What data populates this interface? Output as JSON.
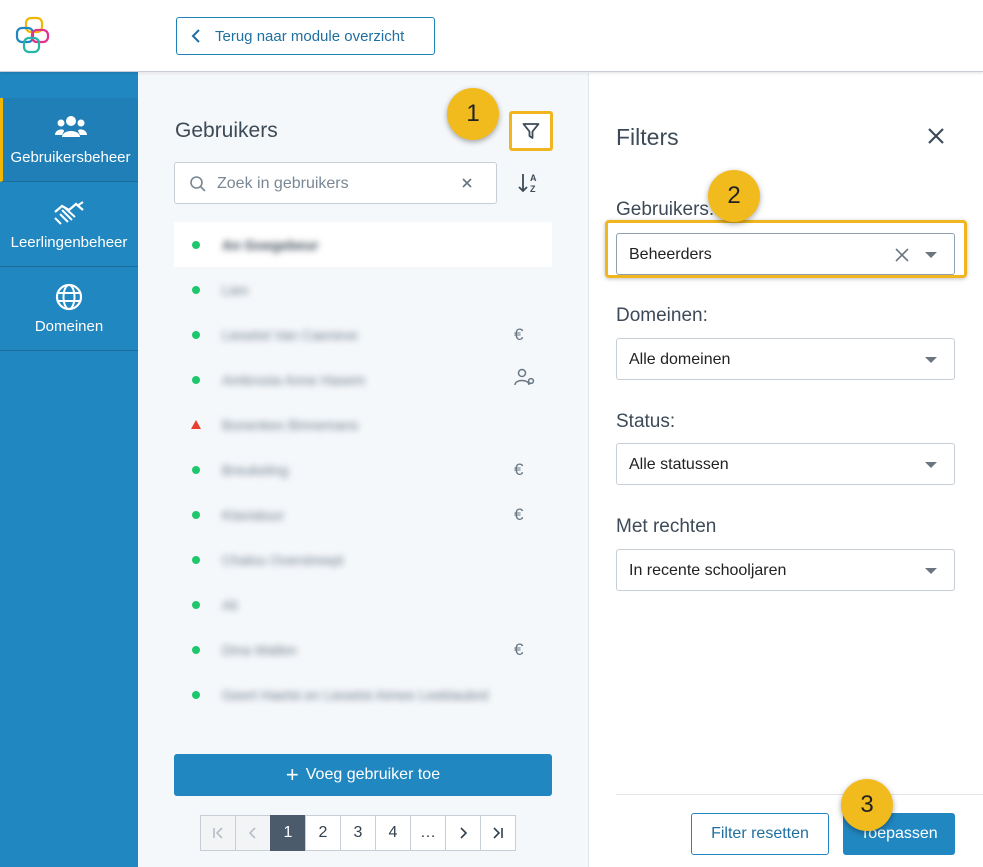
{
  "header": {
    "back_label": "Terug naar module overzicht"
  },
  "sidebar": {
    "items": [
      {
        "label": "Gebruikersbeheer",
        "icon": "users-icon",
        "active": true
      },
      {
        "label": "Leerlingenbeheer",
        "icon": "handshake-icon",
        "active": false
      },
      {
        "label": "Domeinen",
        "icon": "globe-icon",
        "active": false
      }
    ]
  },
  "users": {
    "title": "Gebruikers",
    "search_placeholder": "Zoek in gebruikers",
    "rows": [
      {
        "name": "An Goegebeur",
        "status": "active",
        "icon": ""
      },
      {
        "name": "Lien",
        "status": "active",
        "icon": ""
      },
      {
        "name": "Lieselot Van Caeneve",
        "status": "active",
        "icon": "euro-icon"
      },
      {
        "name": "Ambrosia Anne Hasem",
        "status": "active",
        "icon": "user-gear-icon"
      },
      {
        "name": "Bonenkes Binnemans",
        "status": "warning",
        "icon": ""
      },
      {
        "name": "Breukeling",
        "status": "active",
        "icon": "euro-icon"
      },
      {
        "name": "Klaviatuur",
        "status": "active",
        "icon": "euro-icon"
      },
      {
        "name": "Chalou Overstreept",
        "status": "active",
        "icon": ""
      },
      {
        "name": "Ali",
        "status": "active",
        "icon": ""
      },
      {
        "name": "Dina Wallen",
        "status": "active",
        "icon": "euro-icon"
      },
      {
        "name": "Geert Haelst en Lieselot Aimee Leeklaubrd",
        "status": "active",
        "icon": ""
      }
    ],
    "add_label": "Voeg gebruiker toe",
    "pager": {
      "pages": [
        "1",
        "2",
        "3",
        "4",
        "…"
      ],
      "current": "1"
    }
  },
  "filters": {
    "title": "Filters",
    "fields": [
      {
        "label": "Gebruikers:",
        "value": "Beheerders"
      },
      {
        "label": "Domeinen:",
        "value": "Alle domeinen"
      },
      {
        "label": "Status:",
        "value": "Alle statussen"
      },
      {
        "label": "Met rechten",
        "value": "In recente schooljaren"
      }
    ],
    "reset_label": "Filter resetten",
    "apply_label": "Toepassen"
  },
  "steps": [
    "1",
    "2",
    "3"
  ],
  "colors": {
    "primary": "#2187c0",
    "highlight": "#f1b61f",
    "status_active": "#1ec76b",
    "status_warning": "#e8402f"
  }
}
